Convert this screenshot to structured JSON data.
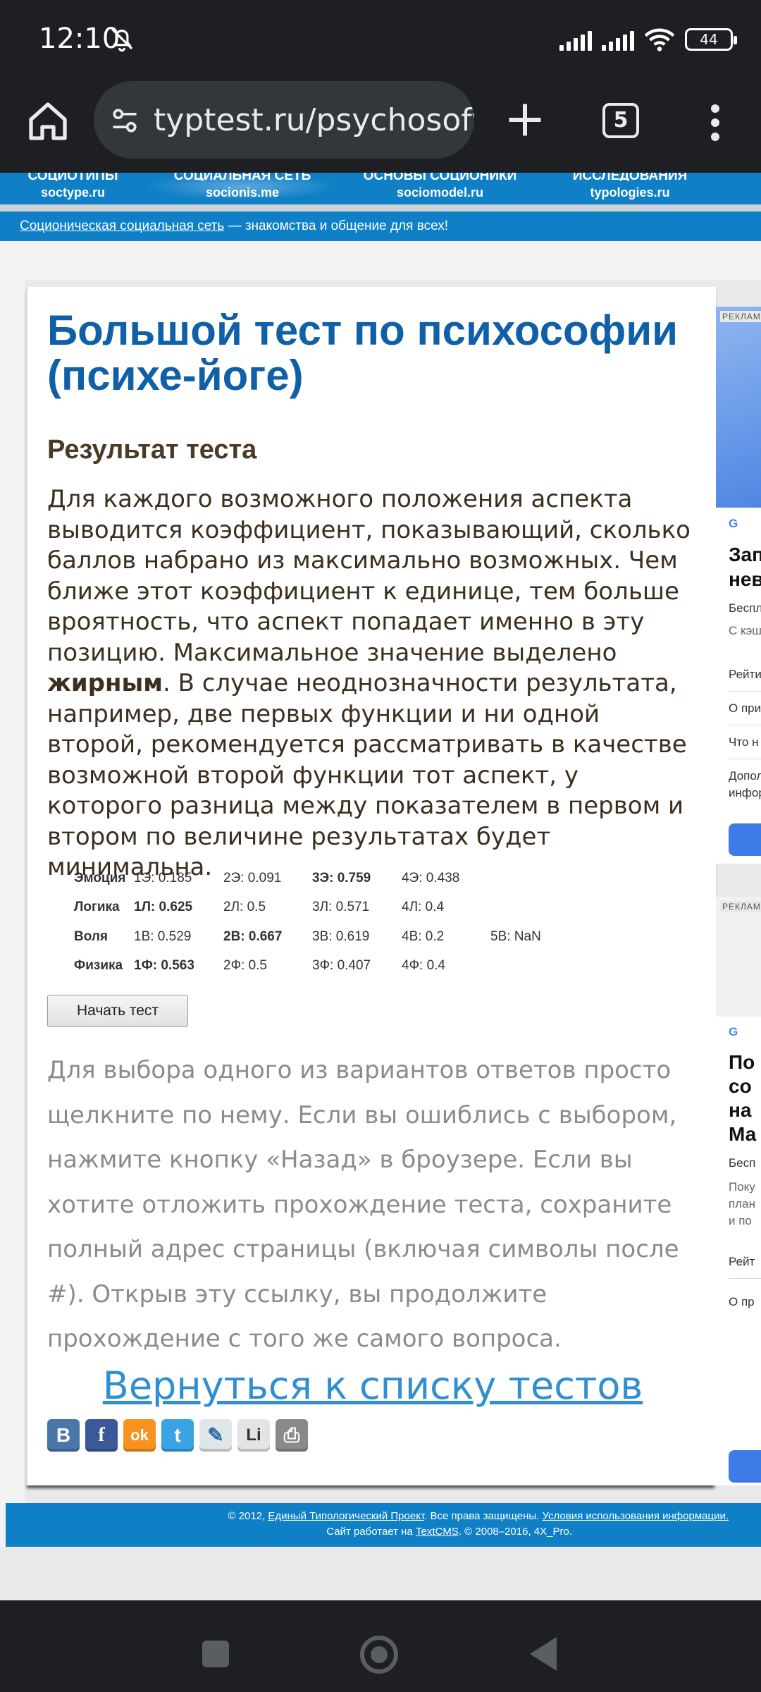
{
  "status_bar": {
    "time": "12:10",
    "battery": "44"
  },
  "browser": {
    "url": "typtest.ru/psychosofy.",
    "tab_count": "5"
  },
  "site_nav": [
    {
      "title": "СОЦИОТИПЫ",
      "domain": "soctype.ru"
    },
    {
      "title": "СОЦИАЛЬНАЯ СЕТЬ",
      "domain": "socionis.me"
    },
    {
      "title": "ОСНОВЫ СОЦИОНИКИ",
      "domain": "sociomodel.ru"
    },
    {
      "title": "ИССЛЕДОВАНИЯ",
      "domain": "typologies.ru"
    }
  ],
  "announce": {
    "link": "Соционическая социальная сеть",
    "text": " — знакомства и общение для всех!"
  },
  "article": {
    "title": "Большой тест по психософии (психе-йоге)",
    "subtitle": "Результат теста",
    "desc_before": "Для каждого возможного положения аспекта выводится коэффициент, показывающий, сколько баллов набрано из максимально возможных. Чем ближе этот коэффициент к единице, тем больше вроятность, что аспект попадает именно в эту позицию. Максимальное значение выделено ",
    "desc_bold": "жирным",
    "desc_after": ". В случае неоднозначности результата, например, две первых функции и ни одной второй, рекомендуется рассматривать в качестве возможной второй функции тот аспект, у которого разница между показателем в первом и втором по величине результатах будет минимальна.",
    "results": [
      {
        "label": "Эмоция",
        "cells": [
          "1Э: 0.185",
          "2Э: 0.091",
          "3Э: 0.759",
          "4Э: 0.438",
          ""
        ]
      },
      {
        "label": "Логика",
        "cells": [
          "1Л: 0.625",
          "2Л: 0.5",
          "3Л: 0.571",
          "4Л: 0.4",
          ""
        ]
      },
      {
        "label": "Воля",
        "cells": [
          "1В: 0.529",
          "2В: 0.667",
          "3В: 0.619",
          "4В: 0.2",
          "5В: NaN"
        ]
      },
      {
        "label": "Физика",
        "cells": [
          "1Ф: 0.563",
          "2Ф: 0.5",
          "3Ф: 0.407",
          "4Ф: 0.4",
          ""
        ]
      }
    ],
    "start_button": "Начать тест",
    "howto": "Для выбора одного из вариантов ответов просто щелкните по нему. Если вы ошиблись с выбором, нажмите кнопку «Назад» в броузере. Если вы хотите отложить прохождение теста, сохраните полный адрес страницы (включая символы после #). Открыв эту ссылку, вы продолжите прохождение с того же самого вопроса.",
    "back_link": "Вернуться к списку тестов",
    "share_icons": [
      {
        "glyph": "В",
        "color": "#4a76a8",
        "name": "vk-icon"
      },
      {
        "glyph": "f",
        "color": "#3b5998",
        "name": "facebook-icon"
      },
      {
        "glyph": "ok",
        "color": "#f7931e",
        "name": "odnoklassniki-icon"
      },
      {
        "glyph": "t",
        "color": "#3aa3e3",
        "name": "twitter-icon"
      },
      {
        "glyph": "✎",
        "color": "#dfe6ea",
        "name": "livejournal-icon"
      },
      {
        "glyph": "Li",
        "color": "#e4e4e4",
        "name": "liveinternet-icon"
      },
      {
        "glyph": "⎙",
        "color": "#8a8a8a",
        "name": "print-icon"
      }
    ]
  },
  "ads": {
    "tag": "РЕКЛАМА",
    "ad1": {
      "store": "G",
      "title1": "Зап",
      "title2": "нев",
      "line1": "Беспл",
      "line2": "С кэш",
      "item1": "Рейти",
      "item2": "О при",
      "item3": "Что н",
      "item4a": "Допол",
      "item4b": "инфор"
    },
    "ad2": {
      "store": "G",
      "title1": "По",
      "title2": "со",
      "title3": "на",
      "title4": "Ма",
      "line1": "Бесп",
      "line2": "Поку",
      "line3": "план",
      "line4": "и по",
      "item1": "Рейт",
      "item2": "О пр"
    }
  },
  "footer": {
    "line1_pre": "© 2012, ",
    "line1_link1": "Единый Типологический Проект",
    "line1_mid": ". Все права защищены. ",
    "line1_link2": "Условия использования информации.",
    "line2_pre": "Сайт работает на ",
    "line2_link": "TextCMS",
    "line2_post": ". © 2008–2016, 4X_Pro."
  }
}
